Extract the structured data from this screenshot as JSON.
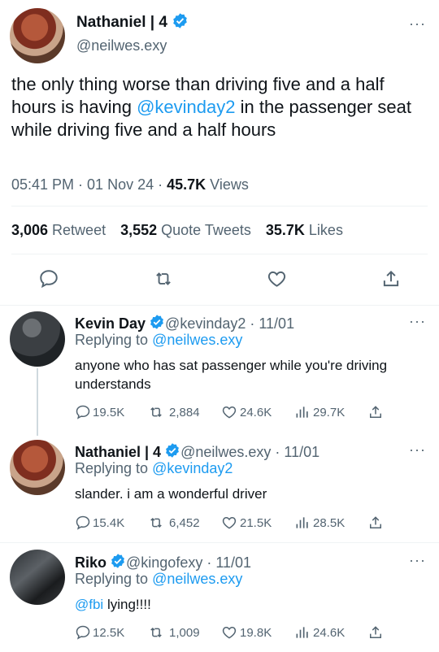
{
  "main_tweet": {
    "display_name": "Nathaniel | 4",
    "handle": "@neilwes.exy",
    "text_before": "the only thing worse than driving five and a half hours is having ",
    "mention": "@kevinday2",
    "text_after": " in the passenger seat while driving five and a half hours",
    "time": "05:41 PM · 01 Nov 24 · ",
    "views_count": "45.7K",
    "views_label": " Views",
    "retweets_count": "3,006",
    "retweets_label": " Retweet",
    "quotes_count": "3,552",
    "quotes_label": " Quote Tweets",
    "likes_count": "35.7K",
    "likes_label": " Likes"
  },
  "replies": [
    {
      "display_name": "Kevin Day",
      "meta": " @kevinday2 · 11/01",
      "replying_prefix": "Replying to ",
      "replying_handle": "@neilwes.exy",
      "text": "anyone who has sat passenger while you're driving understands",
      "replies": "19.5K",
      "retweets": "2,884",
      "likes": "24.6K",
      "views": "29.7K"
    },
    {
      "display_name": "Nathaniel | 4",
      "meta": " @neilwes.exy · 11/01",
      "replying_prefix": "Replying to ",
      "replying_handle": "@kevinday2",
      "text": "slander. i am a wonderful driver",
      "replies": "15.4K",
      "retweets": "6,452",
      "likes": "21.5K",
      "views": "28.5K"
    },
    {
      "display_name": "Riko",
      "meta": " @kingofexy · 11/01",
      "replying_prefix": "Replying to ",
      "replying_handle": "@neilwes.exy",
      "text_mention": "@fbi",
      "text": " lying!!!!",
      "replies": "12.5K",
      "retweets": "1,009",
      "likes": "19.8K",
      "views": "24.6K"
    }
  ],
  "colors": {
    "accent": "#1d9bf0",
    "muted": "#536471",
    "text": "#0f1419",
    "divider": "#eff3f4"
  }
}
